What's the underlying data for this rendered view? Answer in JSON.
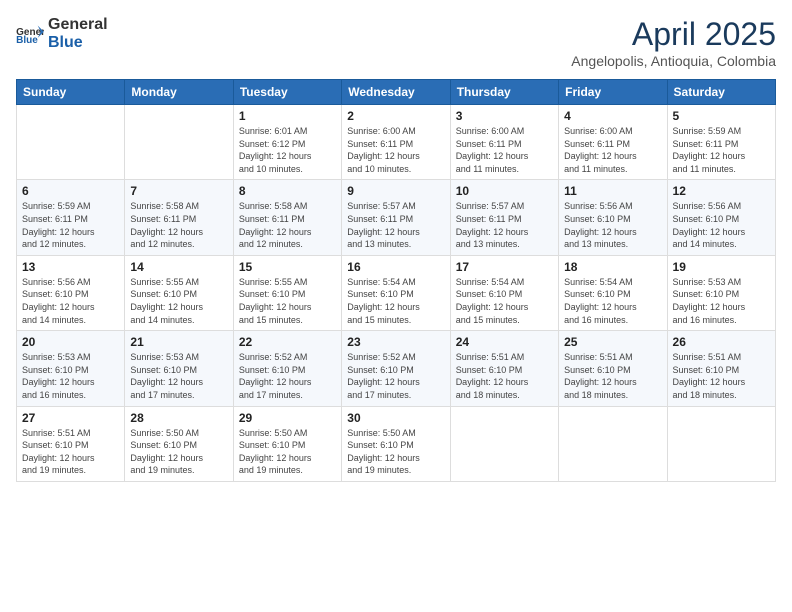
{
  "header": {
    "logo_general": "General",
    "logo_blue": "Blue",
    "month_year": "April 2025",
    "location": "Angelopolis, Antioquia, Colombia"
  },
  "days_of_week": [
    "Sunday",
    "Monday",
    "Tuesday",
    "Wednesday",
    "Thursday",
    "Friday",
    "Saturday"
  ],
  "weeks": [
    [
      {
        "day": "",
        "content": ""
      },
      {
        "day": "",
        "content": ""
      },
      {
        "day": "1",
        "content": "Sunrise: 6:01 AM\nSunset: 6:12 PM\nDaylight: 12 hours\nand 10 minutes."
      },
      {
        "day": "2",
        "content": "Sunrise: 6:00 AM\nSunset: 6:11 PM\nDaylight: 12 hours\nand 10 minutes."
      },
      {
        "day": "3",
        "content": "Sunrise: 6:00 AM\nSunset: 6:11 PM\nDaylight: 12 hours\nand 11 minutes."
      },
      {
        "day": "4",
        "content": "Sunrise: 6:00 AM\nSunset: 6:11 PM\nDaylight: 12 hours\nand 11 minutes."
      },
      {
        "day": "5",
        "content": "Sunrise: 5:59 AM\nSunset: 6:11 PM\nDaylight: 12 hours\nand 11 minutes."
      }
    ],
    [
      {
        "day": "6",
        "content": "Sunrise: 5:59 AM\nSunset: 6:11 PM\nDaylight: 12 hours\nand 12 minutes."
      },
      {
        "day": "7",
        "content": "Sunrise: 5:58 AM\nSunset: 6:11 PM\nDaylight: 12 hours\nand 12 minutes."
      },
      {
        "day": "8",
        "content": "Sunrise: 5:58 AM\nSunset: 6:11 PM\nDaylight: 12 hours\nand 12 minutes."
      },
      {
        "day": "9",
        "content": "Sunrise: 5:57 AM\nSunset: 6:11 PM\nDaylight: 12 hours\nand 13 minutes."
      },
      {
        "day": "10",
        "content": "Sunrise: 5:57 AM\nSunset: 6:11 PM\nDaylight: 12 hours\nand 13 minutes."
      },
      {
        "day": "11",
        "content": "Sunrise: 5:56 AM\nSunset: 6:10 PM\nDaylight: 12 hours\nand 13 minutes."
      },
      {
        "day": "12",
        "content": "Sunrise: 5:56 AM\nSunset: 6:10 PM\nDaylight: 12 hours\nand 14 minutes."
      }
    ],
    [
      {
        "day": "13",
        "content": "Sunrise: 5:56 AM\nSunset: 6:10 PM\nDaylight: 12 hours\nand 14 minutes."
      },
      {
        "day": "14",
        "content": "Sunrise: 5:55 AM\nSunset: 6:10 PM\nDaylight: 12 hours\nand 14 minutes."
      },
      {
        "day": "15",
        "content": "Sunrise: 5:55 AM\nSunset: 6:10 PM\nDaylight: 12 hours\nand 15 minutes."
      },
      {
        "day": "16",
        "content": "Sunrise: 5:54 AM\nSunset: 6:10 PM\nDaylight: 12 hours\nand 15 minutes."
      },
      {
        "day": "17",
        "content": "Sunrise: 5:54 AM\nSunset: 6:10 PM\nDaylight: 12 hours\nand 15 minutes."
      },
      {
        "day": "18",
        "content": "Sunrise: 5:54 AM\nSunset: 6:10 PM\nDaylight: 12 hours\nand 16 minutes."
      },
      {
        "day": "19",
        "content": "Sunrise: 5:53 AM\nSunset: 6:10 PM\nDaylight: 12 hours\nand 16 minutes."
      }
    ],
    [
      {
        "day": "20",
        "content": "Sunrise: 5:53 AM\nSunset: 6:10 PM\nDaylight: 12 hours\nand 16 minutes."
      },
      {
        "day": "21",
        "content": "Sunrise: 5:53 AM\nSunset: 6:10 PM\nDaylight: 12 hours\nand 17 minutes."
      },
      {
        "day": "22",
        "content": "Sunrise: 5:52 AM\nSunset: 6:10 PM\nDaylight: 12 hours\nand 17 minutes."
      },
      {
        "day": "23",
        "content": "Sunrise: 5:52 AM\nSunset: 6:10 PM\nDaylight: 12 hours\nand 17 minutes."
      },
      {
        "day": "24",
        "content": "Sunrise: 5:51 AM\nSunset: 6:10 PM\nDaylight: 12 hours\nand 18 minutes."
      },
      {
        "day": "25",
        "content": "Sunrise: 5:51 AM\nSunset: 6:10 PM\nDaylight: 12 hours\nand 18 minutes."
      },
      {
        "day": "26",
        "content": "Sunrise: 5:51 AM\nSunset: 6:10 PM\nDaylight: 12 hours\nand 18 minutes."
      }
    ],
    [
      {
        "day": "27",
        "content": "Sunrise: 5:51 AM\nSunset: 6:10 PM\nDaylight: 12 hours\nand 19 minutes."
      },
      {
        "day": "28",
        "content": "Sunrise: 5:50 AM\nSunset: 6:10 PM\nDaylight: 12 hours\nand 19 minutes."
      },
      {
        "day": "29",
        "content": "Sunrise: 5:50 AM\nSunset: 6:10 PM\nDaylight: 12 hours\nand 19 minutes."
      },
      {
        "day": "30",
        "content": "Sunrise: 5:50 AM\nSunset: 6:10 PM\nDaylight: 12 hours\nand 19 minutes."
      },
      {
        "day": "",
        "content": ""
      },
      {
        "day": "",
        "content": ""
      },
      {
        "day": "",
        "content": ""
      }
    ]
  ]
}
